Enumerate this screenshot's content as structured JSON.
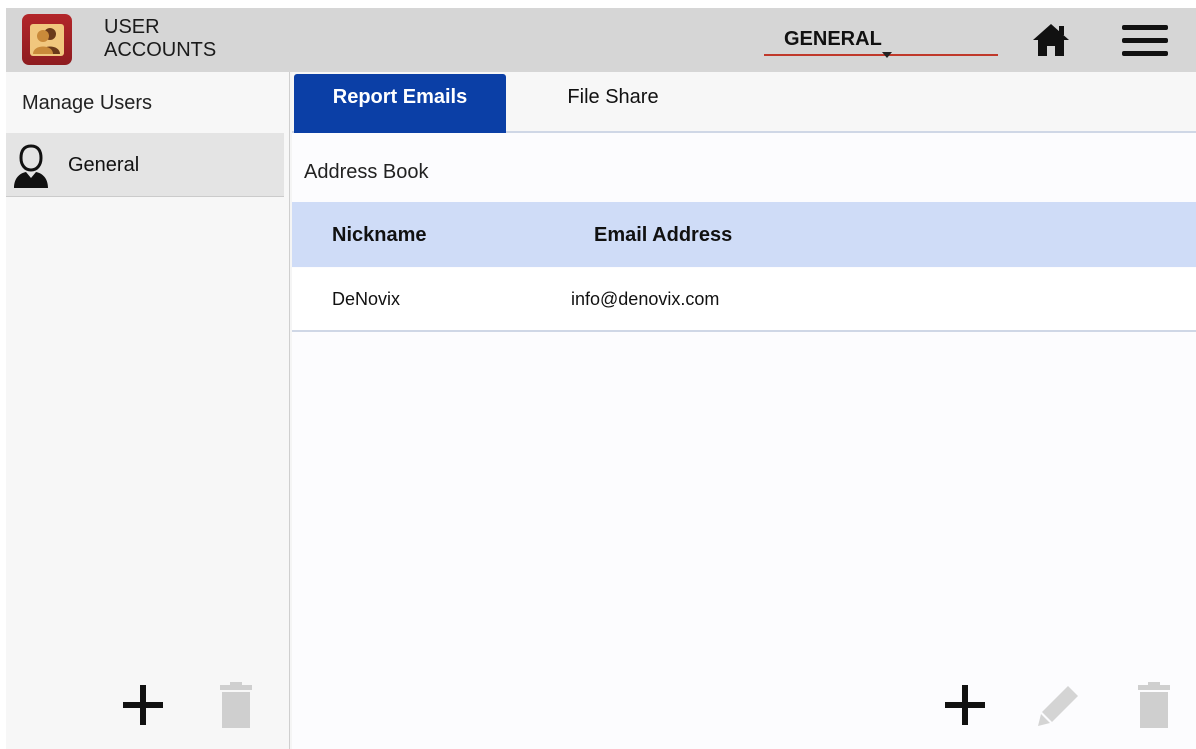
{
  "header": {
    "app_title_line1": "USER",
    "app_title_line2": "ACCOUNTS",
    "app_icon": "user-accounts-icon",
    "context_value": "GENERAL",
    "home_icon": "home-icon",
    "menu_icon": "hamburger-menu-icon"
  },
  "sidebar": {
    "title": "Manage Users",
    "items": [
      {
        "label": "General",
        "icon": "user-silhouette-icon",
        "selected": true
      }
    ],
    "add_icon": "plus-icon",
    "delete_icon": "trash-icon"
  },
  "main": {
    "tabs": [
      {
        "label": "Report Emails",
        "active": true
      },
      {
        "label": "File Share",
        "active": false
      }
    ],
    "section_title": "Address Book",
    "table": {
      "columns": [
        "Nickname",
        "Email Address"
      ],
      "rows": [
        [
          "DeNovix",
          "info@denovix.com"
        ]
      ]
    },
    "add_icon": "plus-icon",
    "edit_icon": "pencil-icon",
    "delete_icon": "trash-icon"
  },
  "colors": {
    "header_bg": "#d6d6d6",
    "active_tab": "#0b3fa6",
    "table_header_bg": "#cfdcf7",
    "app_icon_red": "#b3262a",
    "disabled_icon": "#cfcfcf",
    "underline_red": "#c0392b"
  }
}
